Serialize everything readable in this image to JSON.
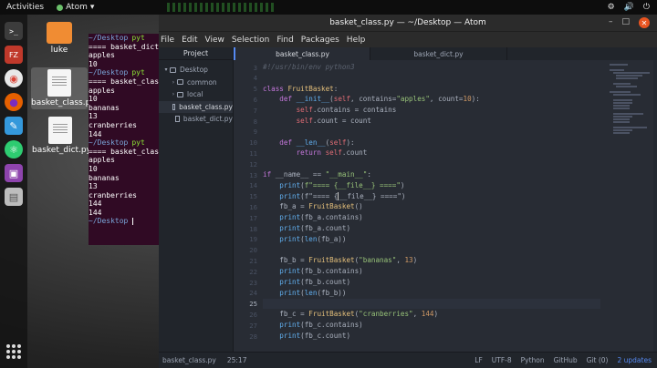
{
  "topbar": {
    "activities": "Activities",
    "app_name": "Atom",
    "app_arrow": "▾",
    "clock": "",
    "tray": [
      "⚙",
      "🔊",
      "⏻"
    ]
  },
  "dock": {
    "icons": [
      {
        "name": "terminal-icon",
        "color": "#3c3c3c",
        "glyph": ">_"
      },
      {
        "name": "filezilla-icon",
        "color": "#c0392b",
        "glyph": "FZ"
      },
      {
        "name": "chrome-icon",
        "color": "#e8e8e8",
        "glyph": "◉"
      },
      {
        "name": "firefox-icon",
        "color": "#e66000",
        "glyph": "●"
      },
      {
        "name": "editor-icon",
        "color": "#3498db",
        "glyph": "✎"
      },
      {
        "name": "atom-icon",
        "color": "#2ecc71",
        "glyph": "⚛"
      },
      {
        "name": "screen-icon",
        "color": "#8e44ad",
        "glyph": "▣"
      },
      {
        "name": "notes-icon",
        "color": "#bdbdbd",
        "glyph": "▤"
      }
    ]
  },
  "desktop_icons": [
    {
      "label": "luke",
      "kind": "folder"
    },
    {
      "label": "basket_class.py",
      "kind": "file",
      "selected": true
    },
    {
      "label": "basket_dict.py",
      "kind": "file"
    }
  ],
  "terminal": {
    "lines": [
      {
        "prompt": "~/Desktop",
        "cmd": "pyt"
      },
      {
        "text": "==== basket_dict"
      },
      {
        "text": "apples"
      },
      {
        "text": "10"
      },
      {
        "prompt": "~/Desktop",
        "cmd": "pyt"
      },
      {
        "text": "==== basket_clas"
      },
      {
        "text": "apples"
      },
      {
        "text": "10"
      },
      {
        "text": "bananas"
      },
      {
        "text": "13"
      },
      {
        "text": "cranberries"
      },
      {
        "text": "144"
      },
      {
        "prompt": "~/Desktop",
        "cmd": "pyt"
      },
      {
        "text": "==== basket_clas"
      },
      {
        "text": "apples"
      },
      {
        "text": "10"
      },
      {
        "text": "bananas"
      },
      {
        "text": "13"
      },
      {
        "text": "cranberries"
      },
      {
        "text": "144"
      },
      {
        "text": "144"
      },
      {
        "prompt": "~/Desktop",
        "cursor": true
      }
    ]
  },
  "atom": {
    "title": "basket_class.py — ~/Desktop — Atom",
    "window_controls": {
      "minimize": "–",
      "maximize": "□",
      "close": "✕"
    },
    "menu": [
      "File",
      "Edit",
      "View",
      "Selection",
      "Find",
      "Packages",
      "Help"
    ],
    "project_tab": "Project",
    "tree": [
      {
        "label": "Desktop",
        "arrow": "▾",
        "kind": "folder",
        "indent": 0
      },
      {
        "label": "common",
        "arrow": "›",
        "kind": "folder",
        "indent": 1
      },
      {
        "label": "local",
        "arrow": "›",
        "kind": "folder",
        "indent": 1
      },
      {
        "label": "basket_class.py",
        "kind": "file",
        "indent": 1,
        "selected": true
      },
      {
        "label": "basket_dict.py",
        "kind": "file",
        "indent": 1
      }
    ],
    "tabs": [
      {
        "label": "basket_class.py",
        "active": true
      },
      {
        "label": "basket_dict.py",
        "active": false
      }
    ],
    "code": [
      {
        "n": "1",
        "t": "#!/usr/bin/env python3"
      },
      {
        "n": "2",
        "t": ""
      },
      {
        "n": "3",
        "t": "class FruitBasket:"
      },
      {
        "n": "4",
        "t": "    def __init__(self, contains=\"apples\", count=10):"
      },
      {
        "n": "5",
        "t": "        self.contains = contains"
      },
      {
        "n": "6",
        "t": "        self.count = count"
      },
      {
        "n": "7",
        "t": ""
      },
      {
        "n": "8",
        "t": "    def __len__(self):"
      },
      {
        "n": "9",
        "t": "        return self.count"
      },
      {
        "n": "10",
        "t": ""
      },
      {
        "n": "11",
        "t": "if __name__ == \"__main__\":"
      },
      {
        "n": "12",
        "t": "    print(f\"==== {__file__} ====\")"
      },
      {
        "n": "13",
        "t": ""
      },
      {
        "n": "14",
        "t": "    fb_a = FruitBasket()"
      },
      {
        "n": "15",
        "t": "    print(fb_a.contains)"
      },
      {
        "n": "16",
        "t": "    print(fb_a.count)"
      },
      {
        "n": "17",
        "t": "    print(len(fb_a))"
      },
      {
        "n": "18",
        "t": ""
      },
      {
        "n": "19",
        "t": "    fb_b = FruitBasket(\"bananas\", 13)"
      },
      {
        "n": "20",
        "t": "    print(fb_b.contains)"
      },
      {
        "n": "21",
        "t": "    print(fb_b.count)"
      },
      {
        "n": "22",
        "t": "    print(len(fb_b))"
      },
      {
        "n": "23",
        "t": ""
      },
      {
        "n": "24",
        "t": "    fb_c = FruitBasket(\"cranberries\", 144)"
      },
      {
        "n": "25",
        "t": "    print(fb_c.contains)"
      },
      {
        "n": "26",
        "t": "    print(fb_c.count)"
      }
    ],
    "gutter_numbers": [
      "3",
      "4",
      "5",
      "6",
      "7",
      "8",
      "9",
      "10",
      "11",
      "12",
      "13",
      "14",
      "15",
      "16",
      "17",
      "18",
      "19",
      "20",
      "21",
      "22",
      "23",
      "24",
      "25",
      "26",
      "27",
      "28"
    ],
    "current_line_number": "25",
    "status": {
      "file": "basket_class.py",
      "position": "25:17",
      "line_ending": "LF",
      "encoding": "UTF-8",
      "grammar": "Python",
      "github": "GitHub",
      "git": "Git (0)",
      "updates": "2 updates"
    }
  },
  "colors": {
    "terminal_bg": "#300a24",
    "editor_bg": "#282c34",
    "accent": "#568af2"
  }
}
